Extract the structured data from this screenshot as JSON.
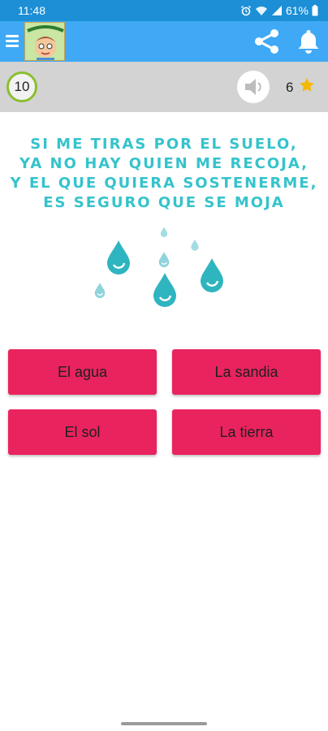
{
  "status_bar": {
    "time": "11:48",
    "battery": "61%"
  },
  "app_bar": {
    "icons": [
      "menu-icon",
      "app-logo",
      "share-icon",
      "bell-icon"
    ],
    "color": "#3fa9f5"
  },
  "game": {
    "timer": "10",
    "score": "6",
    "riddle_lines": [
      "SI ME TIRAS POR EL SUELO,",
      "YA NO HAY QUIEN ME RECOJA,",
      "Y EL QUE QUIERA SOSTENERME,",
      "ES SEGURO QUE SE MOJA"
    ],
    "answers": [
      "El agua",
      "La sandia",
      "El sol",
      "La tierra"
    ],
    "answer_color": "#e9235e",
    "riddle_color": "#35c3cc"
  }
}
